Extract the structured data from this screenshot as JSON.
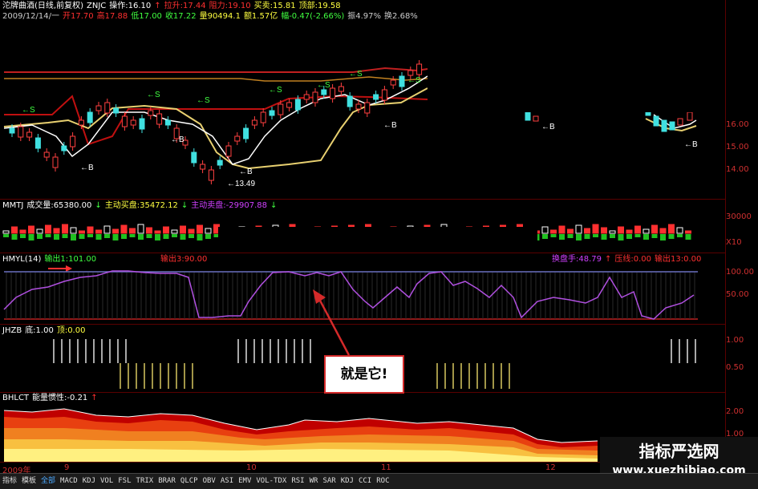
{
  "header": {
    "line1": [
      {
        "text": "沱牌曲酒(日线,前复权)",
        "color": "#ffffff"
      },
      {
        "text": "ZNJC",
        "color": "#ffffff"
      },
      {
        "text": "操作:16.10",
        "color": "#ffffff"
      },
      {
        "text": "↑",
        "color": "#ff3030"
      },
      {
        "text": "拉升:17.44",
        "color": "#ff3030"
      },
      {
        "text": "阻力:19.10",
        "color": "#ff3030"
      },
      {
        "text": "买卖:15.81",
        "color": "#ffff40"
      },
      {
        "text": "顶部:19.58",
        "color": "#ffff40"
      }
    ],
    "line2": [
      {
        "text": "2009/12/14/一",
        "color": "#cccccc"
      },
      {
        "text": "开17.70",
        "color": "#ff3030"
      },
      {
        "text": "高17.88",
        "color": "#ff3030"
      },
      {
        "text": "低17.00",
        "color": "#40ff40"
      },
      {
        "text": "收17.22",
        "color": "#40ff40"
      },
      {
        "text": "量90494.1",
        "color": "#ffff40"
      },
      {
        "text": "额1.57亿",
        "color": "#ffff40"
      },
      {
        "text": "幅-0.47(-2.66%)",
        "color": "#40ff40"
      },
      {
        "text": "振4.97%",
        "color": "#cccccc"
      },
      {
        "text": "换2.68%",
        "color": "#cccccc"
      }
    ],
    "price_axis": [
      "16.00",
      "15.00",
      "14.00"
    ],
    "markers": {
      "sell": "←S",
      "buy": "←B",
      "low_label": "←13.49"
    }
  },
  "volume": {
    "label": "MMTJ",
    "items": [
      {
        "text": "成交量:65380.00",
        "color": "#ffffff"
      },
      {
        "text": "↓",
        "color": "#40ff40"
      },
      {
        "text": "主动买盘:35472.12",
        "color": "#ffff40"
      },
      {
        "text": "↓",
        "color": "#40ff40"
      },
      {
        "text": "主动卖盘:-29907.88",
        "color": "#d040ff"
      },
      {
        "text": "↓",
        "color": "#40ff40"
      }
    ],
    "axis": [
      "30000",
      "X10"
    ]
  },
  "hmyl": {
    "label": "HMYL(14)",
    "items_left": [
      {
        "text": "输出1:101.00",
        "color": "#40ff40"
      }
    ],
    "items_mid": [
      {
        "text": "输出3:90.00",
        "color": "#ff3030"
      }
    ],
    "items_right": [
      {
        "text": "换盘手:48.79",
        "color": "#d040ff"
      },
      {
        "text": "↑",
        "color": "#ff3030"
      },
      {
        "text": "压线:0.00",
        "color": "#ff3030"
      },
      {
        "text": "输出13:0.00",
        "color": "#ff3030"
      }
    ],
    "axis": [
      "100.00",
      "50.00"
    ]
  },
  "jhzb": {
    "label": "JHZB",
    "items": [
      {
        "text": "底:1.00",
        "color": "#ffffff"
      },
      {
        "text": "顶:0.00",
        "color": "#ffff40"
      }
    ],
    "axis": [
      "1.00",
      "0.50"
    ]
  },
  "bhlct": {
    "label": "BHLCT",
    "items": [
      {
        "text": "能量惯性:-0.21",
        "color": "#ffffff"
      },
      {
        "text": "↑",
        "color": "#ff3030"
      }
    ],
    "axis": [
      "2.00",
      "1.00"
    ]
  },
  "date_axis": [
    "2009年",
    "9",
    "10",
    "11",
    "12"
  ],
  "callout": {
    "text": "就是它!"
  },
  "watermark": {
    "cn": "指标严选网",
    "url": "www.xuezhibiao.com"
  },
  "toolbar": {
    "items": [
      "指标",
      "模板",
      "全部",
      "MACD",
      "KDJ",
      "VOL",
      "FSL",
      "TRIX",
      "BRAR",
      "QLCP",
      "OBV",
      "ASI",
      "EMV",
      "VOL-TDX",
      "RSI",
      "WR",
      "SAR",
      "KDJ",
      "CCI",
      "ROC"
    ],
    "active_index": 2
  }
}
